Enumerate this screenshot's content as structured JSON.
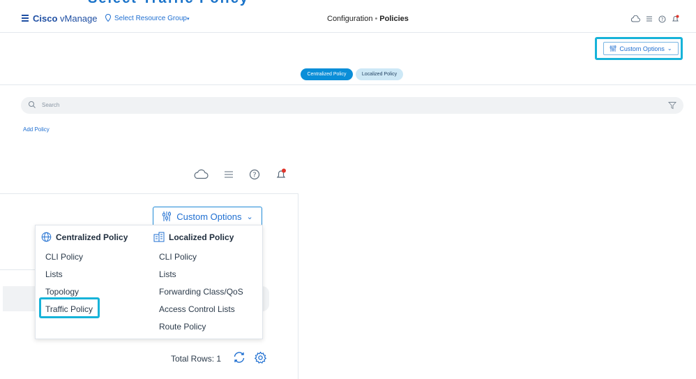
{
  "caption_partial": "Select Traffic Policy",
  "header": {
    "brand_bold": "Cisco",
    "brand_rest": " vManage",
    "resource_group": "Select Resource Group",
    "title_prefix": "Configuration",
    "title_sep": "•",
    "title_main": "Policies"
  },
  "custom_options_label": "Custom Options",
  "tabs": [
    {
      "label": "Centralized Policy",
      "active": true
    },
    {
      "label": "Localized Policy",
      "active": false
    }
  ],
  "search": {
    "placeholder": "Search"
  },
  "add_policy_label": "Add Policy",
  "dropdown": {
    "centralized": {
      "heading": "Centralized Policy",
      "items": [
        "CLI Policy",
        "Lists",
        "Topology",
        "Traffic Policy"
      ]
    },
    "localized": {
      "heading": "Localized Policy",
      "items": [
        "CLI Policy",
        "Lists",
        "Forwarding Class/QoS",
        "Access Control Lists",
        "Route Policy"
      ]
    }
  },
  "total_rows_label": "Total Rows: 1",
  "colors": {
    "accent": "#0a8ed8",
    "highlight": "#17b3d9",
    "link": "#1f6fd1"
  }
}
